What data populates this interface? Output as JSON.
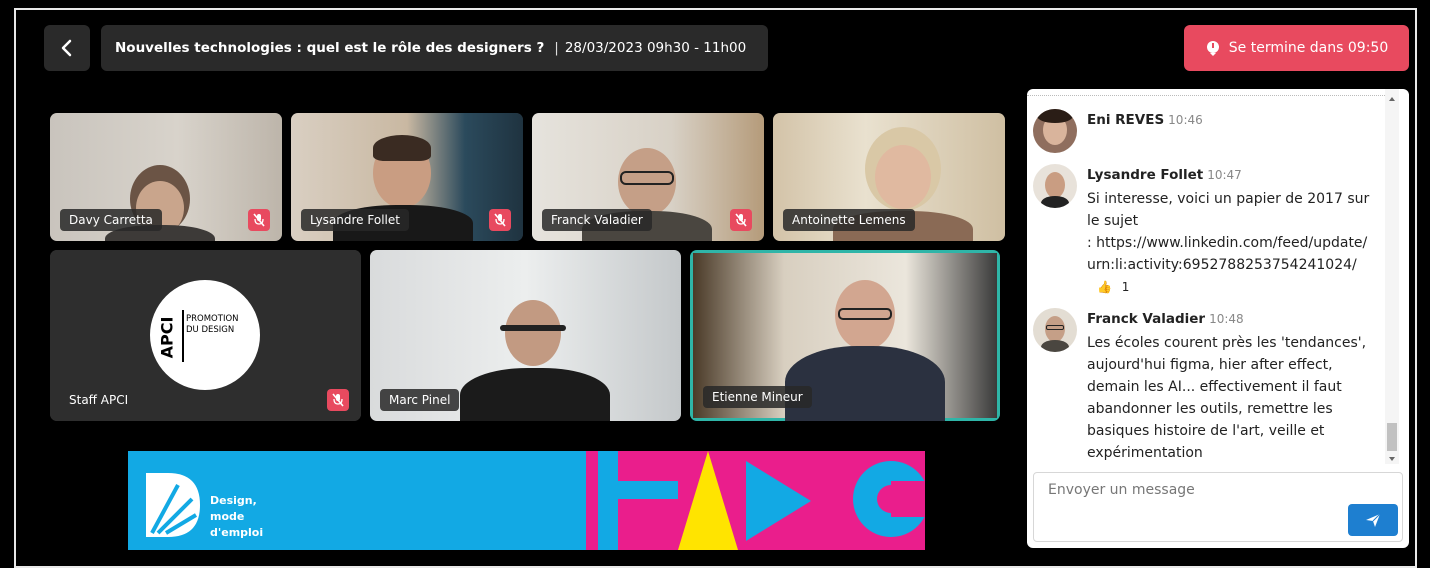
{
  "header": {
    "title": "Nouvelles technologies : quel est le rôle des designers ?",
    "separator": "|",
    "schedule": "28/03/2023 09h30 - 11h00",
    "timer_label": "Se termine dans 09:50"
  },
  "participants": [
    {
      "name": "Davy Carretta",
      "muted": true
    },
    {
      "name": "Lysandre Follet",
      "muted": true
    },
    {
      "name": "Franck Valadier",
      "muted": true
    },
    {
      "name": "Antoinette Lemens",
      "muted": false
    },
    {
      "name": "Staff APCI",
      "muted": true
    },
    {
      "name": "Marc Pinel",
      "muted": false
    },
    {
      "name": "Etienne Mineur",
      "muted": false,
      "active_speaker": true
    }
  ],
  "apci_logo": {
    "acronym": "APCI",
    "line1": "PROMOTION",
    "line2": "DU DESIGN"
  },
  "banner": {
    "line1": "Design,",
    "line2": "mode",
    "line3": "d'emploi"
  },
  "chat": {
    "messages": [
      {
        "author": "Eni REVES",
        "time": "10:46",
        "text": ""
      },
      {
        "author": "Lysandre Follet",
        "time": "10:47",
        "text": "Si interesse, voici un papier de 2017 sur le sujet",
        "link": ": https://www.linkedin.com/feed/update/urn:li:activity:6952788253754241024/",
        "reaction": {
          "emoji": "👍",
          "count": "1"
        }
      },
      {
        "author": "Franck Valadier",
        "time": "10:48",
        "text": "Les écoles courent près les 'tendances', aujourd'hui figma, hier after effect, demain les AI... effectivement il faut abandonner les outils, remettre les basiques histoire de l'art, veille et expérimentation"
      }
    ],
    "input_placeholder": "Envoyer un message"
  },
  "colors": {
    "accent_red": "#e84a5f",
    "active_border": "#2fb5a8",
    "send_blue": "#1e7fd0",
    "banner_blue": "#12a9e4",
    "banner_pink": "#ea1e8c",
    "banner_yellow": "#ffe400"
  }
}
